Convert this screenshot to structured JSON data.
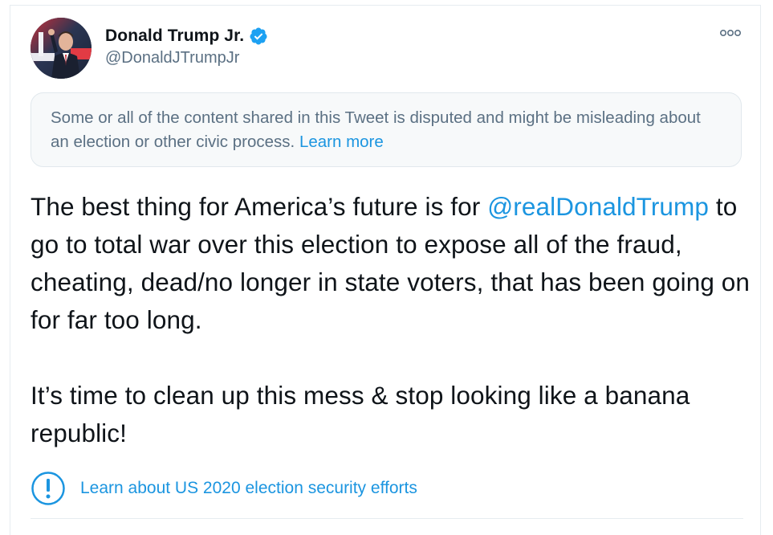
{
  "tweet": {
    "author": {
      "display_name": "Donald Trump Jr.",
      "handle": "@DonaldJTrumpJr",
      "verified_icon": "verified-badge-icon",
      "avatar": "profile-photo"
    },
    "more_icon": "more-options-icon",
    "notice": {
      "text": "Some or all of the content shared in this Tweet is disputed and might be misleading about an election or other civic process. ",
      "link_label": "Learn more"
    },
    "body": {
      "line1_prefix": "The best thing for America’s future is for ",
      "mention": "@realDonaldTrump",
      "line1_suffix": " to go to total war over this election to expose all of the fraud, cheating, dead/no longer in state voters, that has been going on for far too long.",
      "paragraph2": "It’s time to clean up this mess & stop looking like a banana republic!"
    },
    "election_link": {
      "icon": "exclamation-circle-icon",
      "label": "Learn about US 2020 election security efforts"
    }
  },
  "colors": {
    "link_blue": "#1b95e0",
    "verified_blue": "#1da1f2",
    "muted_gray": "#5b7083",
    "notice_bg": "#f7f9fa"
  }
}
